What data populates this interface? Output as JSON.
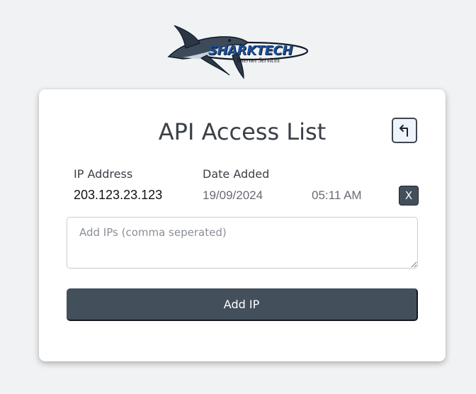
{
  "logo": {
    "wordmark": "SHARKTECH",
    "tagline": "Internet Services"
  },
  "card": {
    "title": "API Access List",
    "back_icon": "return-arrow-icon",
    "columns": {
      "ip": "IP Address",
      "date": "Date Added"
    },
    "entries": [
      {
        "ip": "203.123.23.123",
        "date": "19/09/2024",
        "time": "05:11 AM",
        "remove_label": "X"
      }
    ],
    "textarea": {
      "placeholder": "Add IPs (comma seperated)",
      "value": ""
    },
    "add_button_label": "Add IP"
  },
  "colors": {
    "background": "#f1f2f4",
    "card": "#ffffff",
    "button_dark": "#444f5c",
    "title_text": "#3b4047",
    "muted_text": "#666b72",
    "brand_blue": "#1b4f97"
  }
}
